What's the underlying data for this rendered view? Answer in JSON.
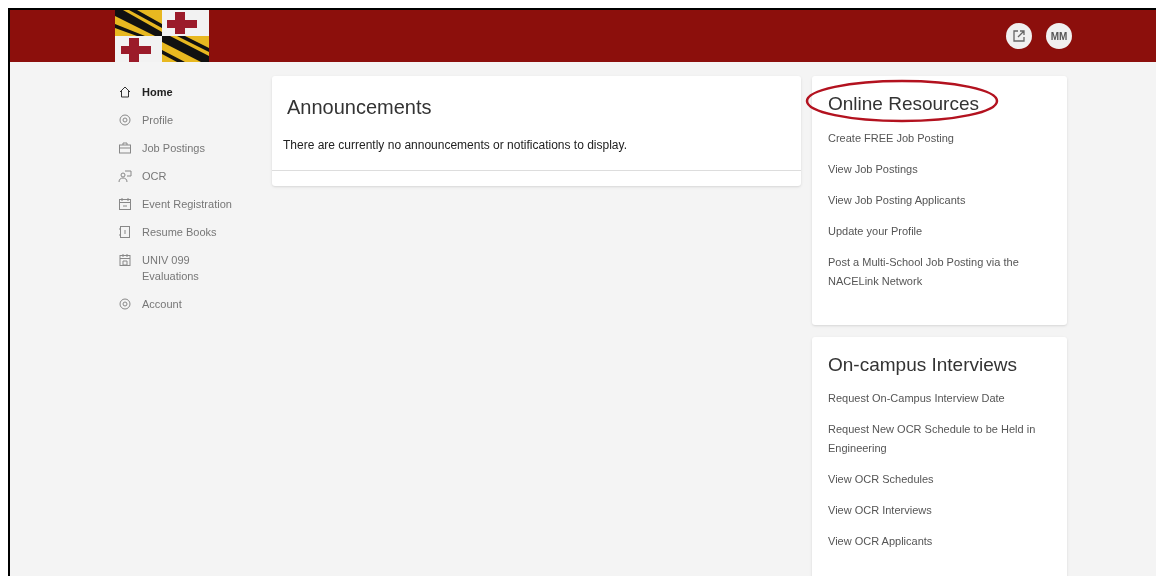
{
  "header": {
    "avatar": "MM"
  },
  "nav": [
    {
      "label": "Home",
      "selected": true
    },
    {
      "label": "Profile",
      "selected": false
    },
    {
      "label": "Job Postings",
      "selected": false
    },
    {
      "label": "OCR",
      "selected": false
    },
    {
      "label": "Event Registration",
      "selected": false
    },
    {
      "label": "Resume Books",
      "selected": false
    },
    {
      "label": "UNIV 099 Evaluations",
      "selected": false
    },
    {
      "label": "Account",
      "selected": false
    }
  ],
  "announcements": {
    "title": "Announcements",
    "message": "There are currently no announcements or notifications to display."
  },
  "panels": [
    {
      "title": "Online Resources",
      "circled": true,
      "links": [
        "Create FREE Job Posting",
        "View Job Postings",
        "View Job Posting Applicants",
        "Update your Profile",
        "Post a Multi-School Job Posting via the NACELink Network"
      ]
    },
    {
      "title": "On-campus Interviews",
      "circled": false,
      "links": [
        "Request On-Campus Interview Date",
        "Request New OCR Schedule to be Held in Engineering",
        "View OCR Schedules",
        "View OCR Interviews",
        "View OCR Applicants"
      ]
    }
  ]
}
